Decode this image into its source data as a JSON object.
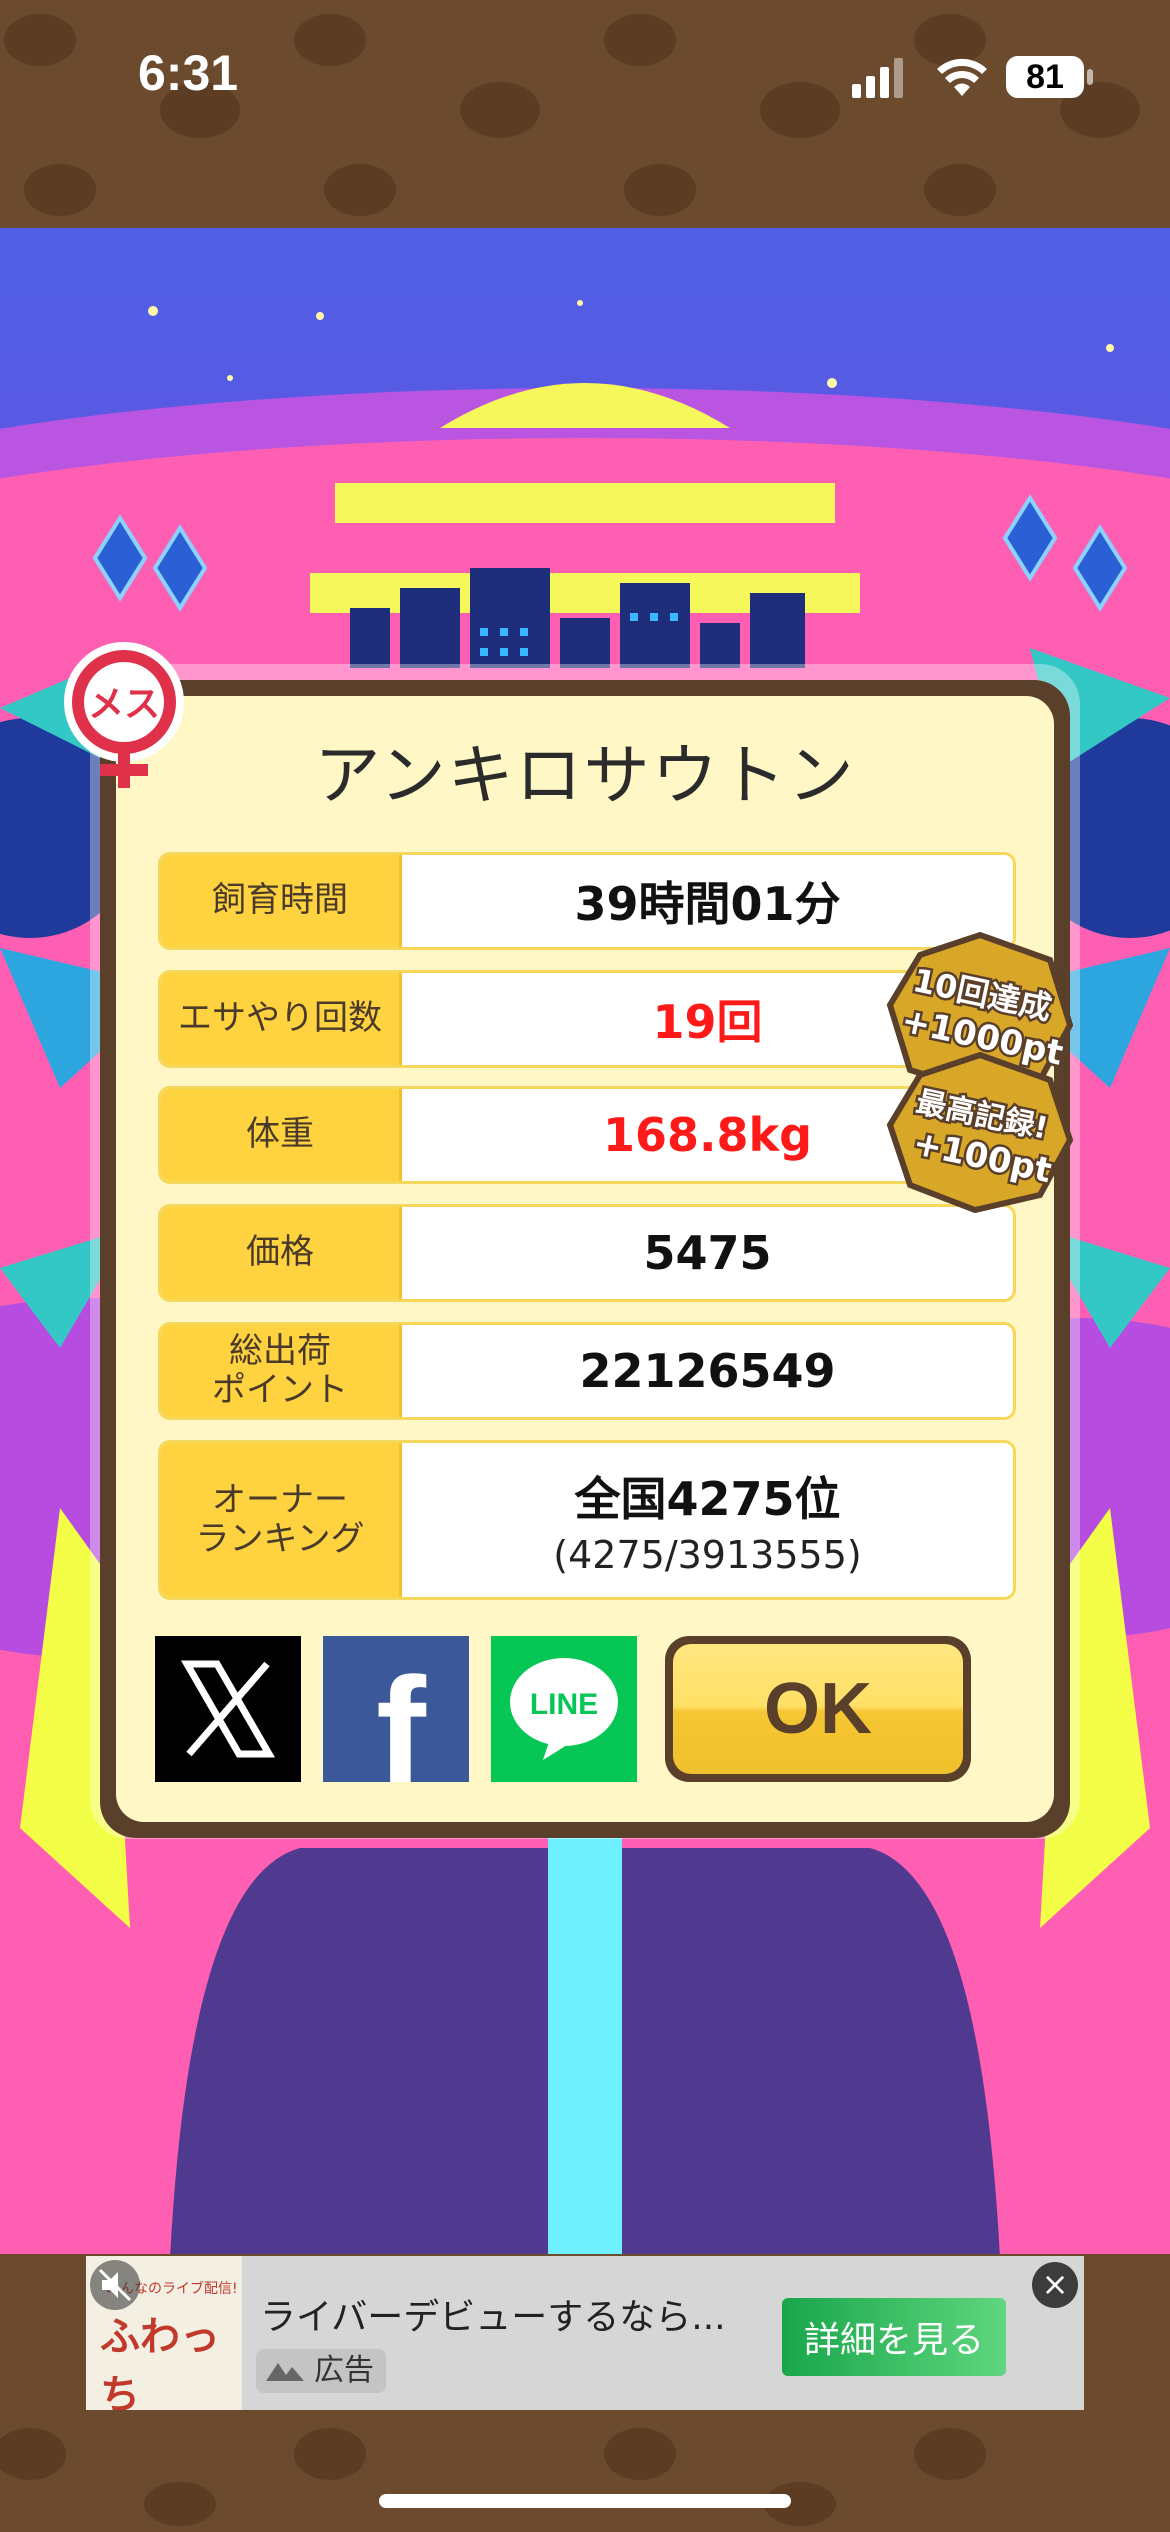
{
  "status_bar": {
    "time": "6:31",
    "battery": "81"
  },
  "gender_badge": "メス",
  "card": {
    "title": "アンキロサウトン",
    "rows": [
      {
        "label": "飼育時間",
        "value": "39時間01分",
        "highlight": false
      },
      {
        "label": "エサやり回数",
        "value": "19回",
        "highlight": true
      },
      {
        "label": "体重",
        "value": "168.8kg",
        "highlight": true
      },
      {
        "label": "価格",
        "value": "5475",
        "highlight": false
      },
      {
        "label": "総出荷\nポイント",
        "value": "22126549",
        "highlight": false
      },
      {
        "label": "オーナー\nランキング",
        "value": "全国4275位",
        "sub": "(4275/3913555)",
        "highlight": false
      }
    ],
    "badges": [
      {
        "line1": "10回達成",
        "line2": "+1000pt"
      },
      {
        "line1": "最高記録!",
        "line2": "+100pt"
      }
    ],
    "share_buttons": {
      "x": "X",
      "facebook": "f",
      "line": "LINE"
    },
    "ok_label": "OK"
  },
  "ad": {
    "thumb_caption": "みんなのライブ配信!",
    "thumb_logo": "ふわっち",
    "title": "ライバーデビューするなら...",
    "tag": "広告",
    "cta": "詳細を見る",
    "close": "×"
  },
  "colors": {
    "label_bg": "#ffd23f",
    "highlight_text": "#ff1a1a",
    "card_border": "#5a3f2a",
    "card_bg": "#fff8c6",
    "cta_green": "#19a64a"
  }
}
